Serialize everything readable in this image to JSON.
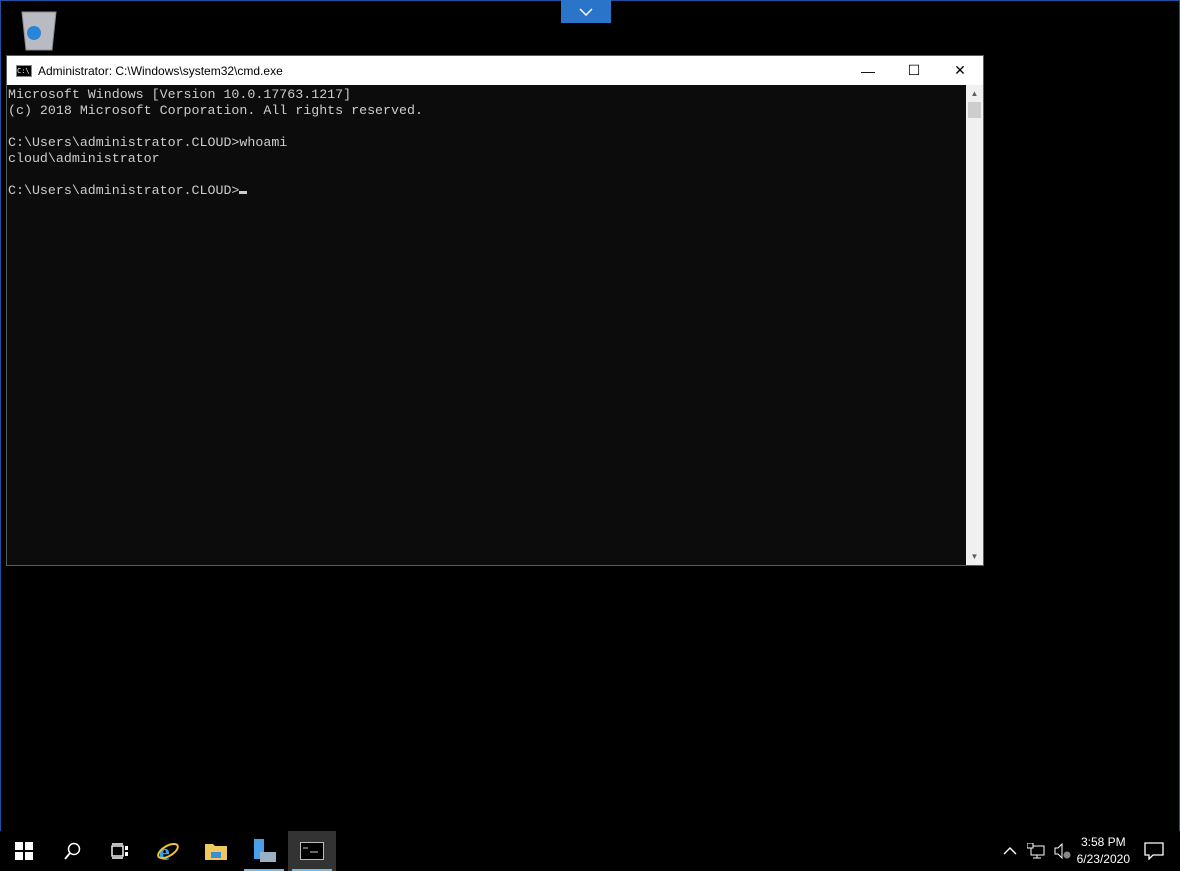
{
  "window": {
    "title": "Administrator: C:\\Windows\\system32\\cmd.exe",
    "minimize": "—",
    "maximize": "☐",
    "close": "✕"
  },
  "console": {
    "lines": [
      "Microsoft Windows [Version 10.0.17763.1217]",
      "(c) 2018 Microsoft Corporation. All rights reserved.",
      "",
      "C:\\Users\\administrator.CLOUD>whoami",
      "cloud\\administrator",
      ""
    ],
    "prompt": "C:\\Users\\administrator.CLOUD>"
  },
  "tray": {
    "time": "3:58 PM",
    "date": "6/23/2020"
  },
  "colors": {
    "accent": "#2a74c9",
    "console_bg": "#0c0c0c"
  }
}
